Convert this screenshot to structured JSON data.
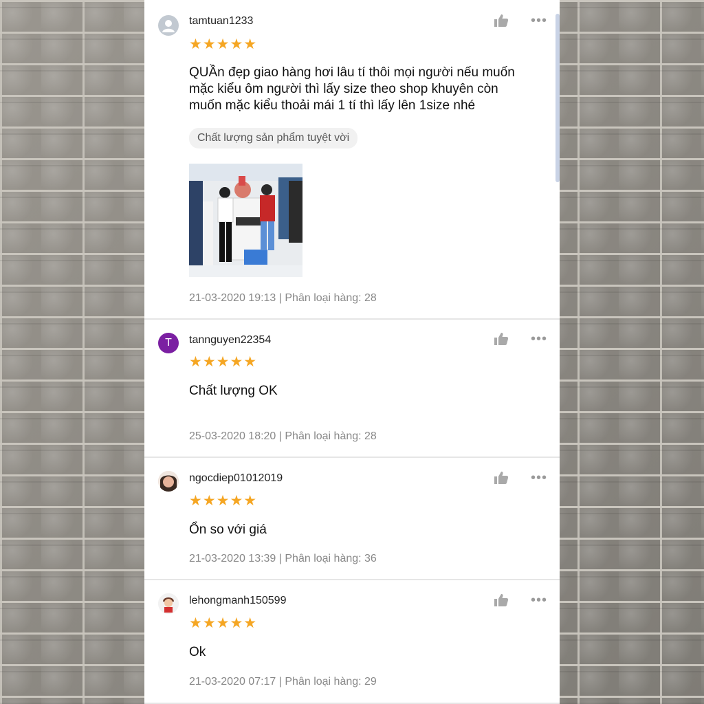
{
  "reviews": [
    {
      "username": "tamtuan1233",
      "avatar": {
        "icon": "person-icon",
        "color": "#c2c9d1"
      },
      "rating": "★★★★★",
      "comment": "QUẦn đẹp giao hàng hơi lâu tí thôi mọi người nếu muốn mặc kiểu ôm người thì lấy size theo shop khuyên còn muốn mặc kiểu thoải mái 1 tí thì lấy lên 1size nhé",
      "comment_lines": [
        "QUẦn đẹp giao hàng hơi lâu tí thôi mọi người nếu muốn",
        "mặc kiểu ôm người thì lấy size theo shop khuyên còn",
        "muốn mặc kiểu thoải mái 1 tí thì lấy lên 1size nhé"
      ],
      "tag": "Chất lượng sản phẩm tuyệt vời",
      "has_photo": true,
      "meta": "21-03-2020 19:13 | Phân loại hàng: 28"
    },
    {
      "username": "tannguyen22354",
      "avatar": {
        "letter": "T",
        "color": "#7b1fa2"
      },
      "rating": "★★★★★",
      "comment": "Chất lượng OK",
      "meta": "25-03-2020 18:20 | Phân loại hàng: 28"
    },
    {
      "username": "ngocdiep01012019",
      "avatar": {
        "icon": "profile-photo",
        "color": "#d9a48a"
      },
      "rating": "★★★★★",
      "comment": "Ổn so với giá",
      "meta": "21-03-2020 13:39 | Phân loại hàng: 36"
    },
    {
      "username": "lehongmanh150599",
      "avatar": {
        "icon": "cartoon-avatar",
        "color": "#e8e8e8"
      },
      "rating": "★★★★★",
      "comment": "Ok",
      "meta": "21-03-2020 07:17 | Phân loại hàng: 29"
    }
  ],
  "icons": {
    "like": "thumbs-up-icon",
    "more": "more-options-icon",
    "more_glyph": "•••"
  },
  "colors": {
    "star": "#f5a623",
    "meta_text": "#888888",
    "tag_bg": "#f1f1f1",
    "like_icon": "#a9a9a9"
  }
}
